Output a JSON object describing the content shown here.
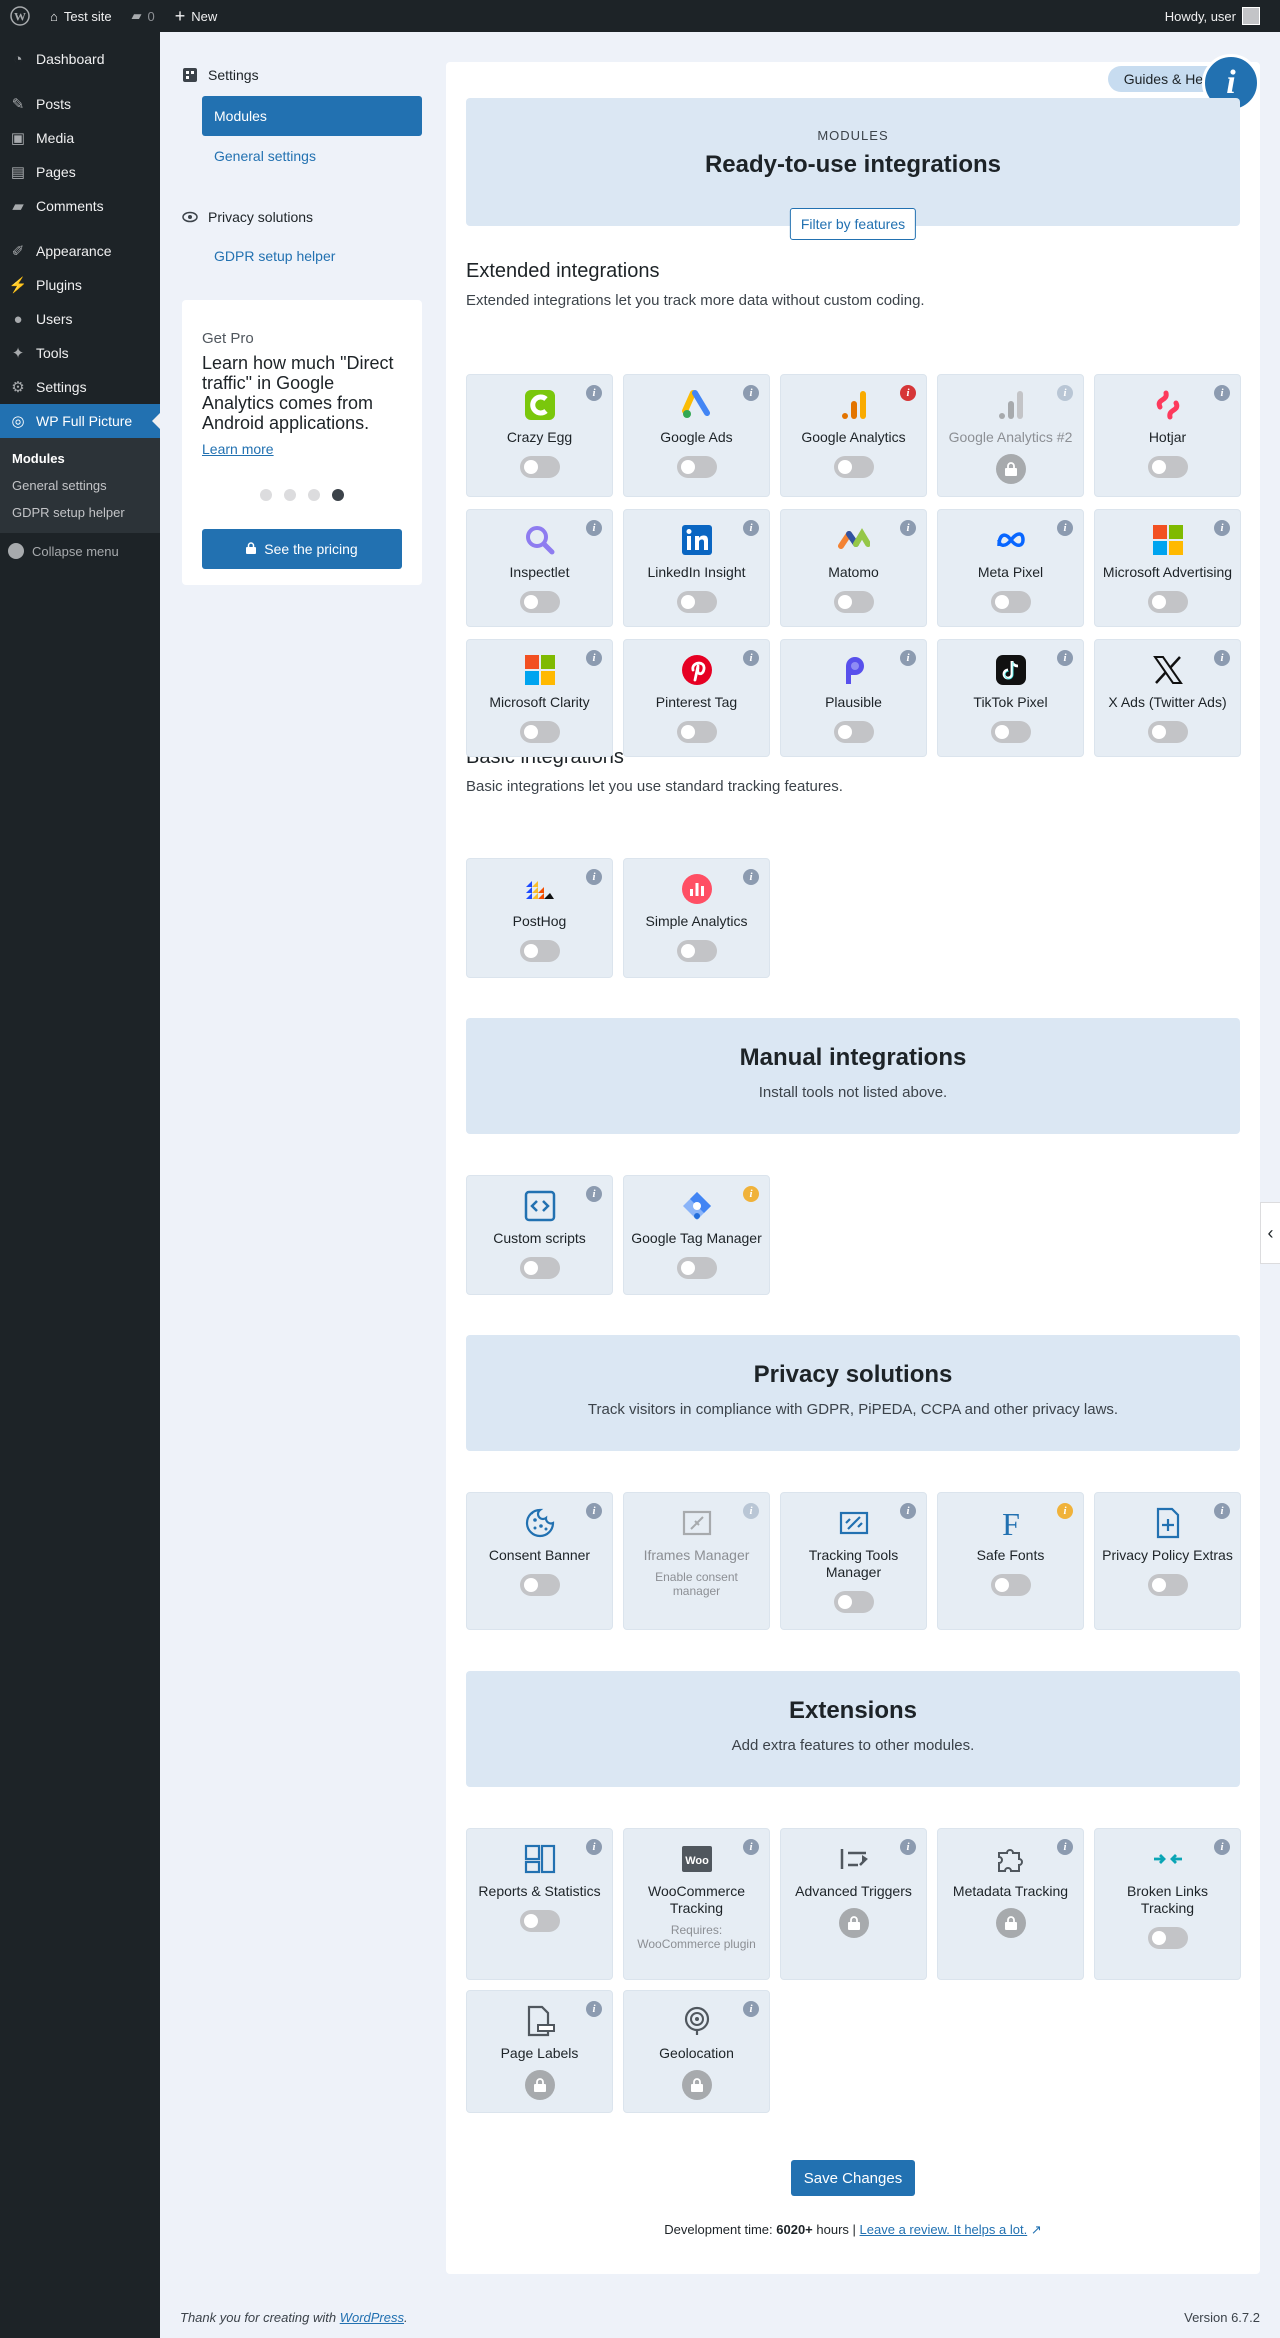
{
  "adminbar": {
    "site": "Test site",
    "comments": "0",
    "new": "New",
    "howdy": "Howdy, user"
  },
  "menu": {
    "dashboard": "Dashboard",
    "posts": "Posts",
    "media": "Media",
    "pages": "Pages",
    "comments": "Comments",
    "appearance": "Appearance",
    "plugins": "Plugins",
    "users": "Users",
    "tools": "Tools",
    "settings": "Settings",
    "wpfp": "WP Full Picture",
    "sub1": "Modules",
    "sub2": "General settings",
    "sub3": "GDPR setup helper",
    "collapse": "Collapse menu"
  },
  "left": {
    "settings": "Settings",
    "modules": "Modules",
    "general": "General settings",
    "privacy": "Privacy solutions",
    "gdpr": "GDPR setup helper"
  },
  "pro": {
    "title": "Get Pro",
    "desc": "Learn how much \"Direct traffic\" in Google Analytics comes from Android applications.",
    "link": "Learn more",
    "button": "See the pricing"
  },
  "main": {
    "guides": "Guides & Help",
    "info": "i",
    "kicker": "MODULES",
    "title": "Ready-to-use integrations",
    "filter": "Filter by features"
  },
  "extended": {
    "title": "Extended integrations",
    "desc": "Extended integrations let you track more data without custom coding.",
    "cards": [
      {
        "name": "Crazy Egg",
        "icon": "crazy-egg-icon"
      },
      {
        "name": "Google Ads",
        "icon": "google-ads-icon"
      },
      {
        "name": "Google Analytics",
        "icon": "google-analytics-icon"
      },
      {
        "name": "Google Analytics #2",
        "icon": "google-analytics-icon"
      },
      {
        "name": "Hotjar",
        "icon": "hotjar-icon"
      },
      {
        "name": "Inspectlet",
        "icon": "inspectlet-icon"
      },
      {
        "name": "LinkedIn Insight",
        "icon": "linkedin-icon"
      },
      {
        "name": "Matomo",
        "icon": "matomo-icon"
      },
      {
        "name": "Meta Pixel",
        "icon": "meta-icon"
      },
      {
        "name": "Microsoft Advertising",
        "icon": "microsoft-icon"
      },
      {
        "name": "Microsoft Clarity",
        "icon": "microsoft-icon"
      },
      {
        "name": "Pinterest Tag",
        "icon": "pinterest-icon"
      },
      {
        "name": "Plausible",
        "icon": "plausible-icon"
      },
      {
        "name": "TikTok Pixel",
        "icon": "tiktok-icon"
      },
      {
        "name": "X Ads (Twitter Ads)",
        "icon": "x-icon"
      }
    ]
  },
  "basic": {
    "title": "Basic integrations",
    "desc": "Basic integrations let you use standard tracking features.",
    "cards": [
      {
        "name": "PostHog",
        "icon": "posthog-icon"
      },
      {
        "name": "Simple Analytics",
        "icon": "simple-analytics-icon"
      }
    ]
  },
  "manual": {
    "title": "Manual integrations",
    "desc": "Install tools not listed above.",
    "cards": [
      {
        "name": "Custom scripts",
        "icon": "code-icon"
      },
      {
        "name": "Google Tag Manager",
        "icon": "gtm-icon"
      }
    ]
  },
  "privacy": {
    "title": "Privacy solutions",
    "desc": "Track visitors in compliance with GDPR, PiPEDA, CCPA and other privacy laws.",
    "cards": [
      {
        "name": "Consent Banner",
        "icon": "cookie-icon"
      },
      {
        "name": "Iframes Manager",
        "icon": "iframe-icon",
        "note": "Enable consent manager"
      },
      {
        "name": "Tracking Tools Manager",
        "icon": "tracking-tools-icon"
      },
      {
        "name": "Safe Fonts",
        "icon": "font-icon"
      },
      {
        "name": "Privacy Policy Extras",
        "icon": "document-plus-icon"
      }
    ]
  },
  "extensions": {
    "title": "Extensions",
    "desc": "Add extra features to other modules.",
    "cards": [
      {
        "name": "Reports & Statistics",
        "icon": "reports-icon"
      },
      {
        "name": "WooCommerce Tracking",
        "icon": "woo-icon",
        "note": "Requires: WooCommerce plugin"
      },
      {
        "name": "Advanced Triggers",
        "icon": "triggers-icon"
      },
      {
        "name": "Metadata Tracking",
        "icon": "puzzle-icon"
      },
      {
        "name": "Broken Links Tracking",
        "icon": "broken-link-icon"
      },
      {
        "name": "Page Labels",
        "icon": "page-label-icon"
      },
      {
        "name": "Geolocation",
        "icon": "geolocation-icon"
      }
    ]
  },
  "save": "Save Changes",
  "dev": {
    "prefix": "Development time:",
    "hours": "6020+",
    "suffix": "hours |",
    "link": "Leave a review. It helps a lot."
  },
  "footer": {
    "thanks": "Thank you for creating with",
    "wp": "WordPress",
    "version": "Version 6.7.2"
  }
}
